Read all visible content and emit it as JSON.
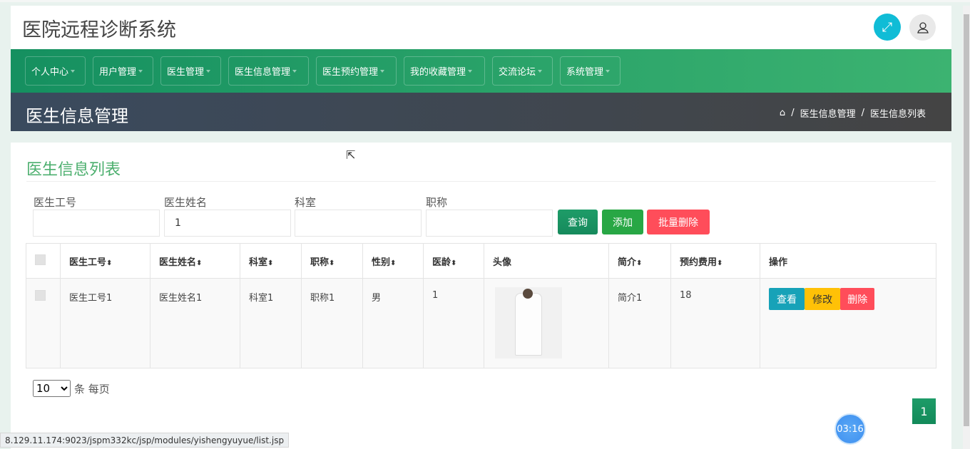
{
  "header": {
    "title": "医院远程诊断系统"
  },
  "nav": [
    {
      "label": "个人中心"
    },
    {
      "label": "用户管理"
    },
    {
      "label": "医生管理"
    },
    {
      "label": "医生信息管理"
    },
    {
      "label": "医生预约管理"
    },
    {
      "label": "我的收藏管理"
    },
    {
      "label": "交流论坛"
    },
    {
      "label": "系统管理"
    }
  ],
  "banner": {
    "title": "医生信息管理",
    "breadcrumb": [
      "医生信息管理",
      "医生信息列表"
    ]
  },
  "card": {
    "title": "医生信息列表"
  },
  "search": {
    "fields": [
      {
        "label": "医生工号",
        "value": ""
      },
      {
        "label": "医生姓名",
        "value": "1"
      },
      {
        "label": "科室",
        "value": ""
      },
      {
        "label": "职称",
        "value": ""
      }
    ],
    "query": "查询",
    "add": "添加",
    "batch_delete": "批量删除"
  },
  "table": {
    "headers": [
      "医生工号",
      "医生姓名",
      "科室",
      "职称",
      "性别",
      "医龄",
      "头像",
      "简介",
      "预约费用",
      "操作"
    ],
    "rows": [
      {
        "id": "医生工号1",
        "name": "医生姓名1",
        "dept": "科室1",
        "title": "职称1",
        "gender": "男",
        "years": "1",
        "intro": "简介1",
        "fee": "18"
      }
    ],
    "actions": {
      "view": "查看",
      "edit": "修改",
      "delete": "删除"
    }
  },
  "pagination": {
    "page_size": "10",
    "per_page": "条 每页",
    "current": "1"
  },
  "timer": "03:16",
  "status_url": "8.129.11.174:9023/jspm332kc/jsp/modules/yishengyuyue/list.jsp",
  "colors": {
    "green": "#1e9c68",
    "danger": "#ff4d5a",
    "warning": "#ffc107",
    "info": "#17a2b8",
    "cyan": "#10bcd6"
  }
}
